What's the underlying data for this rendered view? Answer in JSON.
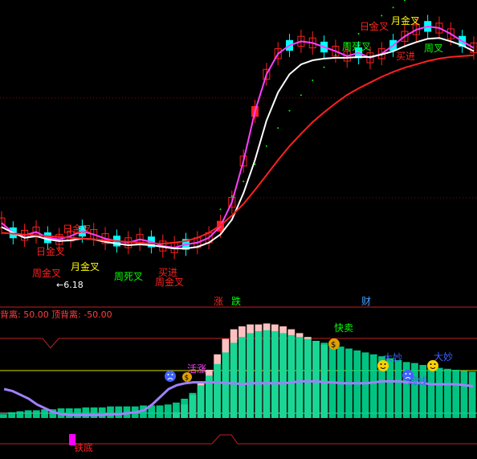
{
  "chart_data": [
    {
      "type": "candlestick",
      "panel": "main",
      "series": [
        {
          "name": "",
          "color": "#ff40ff",
          "values": [
            15.0,
            13.8,
            13.5,
            13.9,
            13.2,
            13.0,
            13.4,
            14.0,
            13.6,
            13.1,
            12.8,
            12.6,
            13.0,
            12.7,
            12.2,
            12.0,
            12.4,
            12.6,
            13.2,
            14.6,
            17.5,
            22.5,
            28.5,
            33.0,
            35.5,
            36.5,
            37.0,
            36.8,
            36.3,
            35.8,
            35.2,
            35.6,
            35.0,
            35.5,
            36.5,
            37.6,
            38.4,
            38.8,
            38.6,
            37.9,
            37.0,
            36.2
          ]
        },
        {
          "name": "",
          "color": "#ffffff",
          "values": [
            14.5,
            13.8,
            13.2,
            13.4,
            13.0,
            12.8,
            12.9,
            13.1,
            13.0,
            12.7,
            12.5,
            12.3,
            12.4,
            12.3,
            12.1,
            11.9,
            11.9,
            12.1,
            12.6,
            13.6,
            15.4,
            18.6,
            22.6,
            27.4,
            30.8,
            33.0,
            34.2,
            34.7,
            34.9,
            35.0,
            35.0,
            35.1,
            35.1,
            35.4,
            35.8,
            36.4,
            36.9,
            37.3,
            37.4,
            37.0,
            36.5,
            35.8
          ]
        },
        {
          "name": "",
          "color": "#ff2020",
          "values": [
            13.8,
            13.7,
            13.6,
            13.5,
            13.4,
            13.3,
            13.2,
            13.1,
            13.0,
            12.9,
            12.8,
            12.7,
            12.6,
            12.5,
            12.5,
            12.6,
            12.8,
            13.2,
            13.8,
            14.7,
            15.9,
            17.3,
            19.0,
            20.8,
            22.6,
            24.3,
            25.8,
            27.2,
            28.4,
            29.5,
            30.5,
            31.3,
            32.0,
            32.7,
            33.3,
            33.8,
            34.2,
            34.6,
            34.9,
            35.1,
            35.2,
            35.3
          ]
        }
      ],
      "annotations": [
        {
          "text": "日金叉",
          "color": "#ff2020"
        },
        {
          "text": "日金叉",
          "color": "#ff2020"
        },
        {
          "text": "月金叉",
          "color": "#ffff00"
        },
        {
          "text": "周金叉",
          "color": "#ff2020"
        },
        {
          "text": "周金叉",
          "color": "#ff2020"
        },
        {
          "text": "买进",
          "color": "#ff2020"
        },
        {
          "text": "买进",
          "color": "#ff2020"
        },
        {
          "text": "周死叉",
          "color": "#00ff00"
        },
        {
          "text": "周死叉",
          "color": "#00ff00"
        },
        {
          "text": "周叉",
          "color": "#00ff00"
        },
        {
          "text": "日金叉",
          "color": "#ff2020"
        },
        {
          "text": "月金叉",
          "color": "#ffff00"
        },
        {
          "text": "←6.18",
          "color": "#ffffff"
        }
      ]
    },
    {
      "type": "bar",
      "panel": "indicator",
      "labels": {
        "bottom_divergence": "背离: 50.00",
        "top_divergence": "顶背离: -50.00"
      },
      "tags": [
        {
          "text": "涨",
          "color": "#ff2020"
        },
        {
          "text": "跌",
          "color": "#00ff00"
        },
        {
          "text": "财",
          "color": "#40a0ff"
        }
      ],
      "annotations": [
        {
          "text": "快卖",
          "color": "#00ff00"
        },
        {
          "text": "大妙",
          "color": "#4060ff"
        },
        {
          "text": "大妙",
          "color": "#4060ff"
        },
        {
          "text": "周线",
          "color": "#4060ff"
        },
        {
          "text": "活涨",
          "color": "#ff40ff"
        },
        {
          "text": "铁底",
          "color": "#ff2020"
        }
      ],
      "series": [
        {
          "name": "",
          "color": "#00d890",
          "values": [
            4,
            6,
            7,
            8,
            8,
            9,
            9,
            10,
            10,
            10,
            11,
            11,
            11,
            12,
            12,
            12,
            12,
            13,
            13,
            13,
            14,
            16,
            20,
            26,
            34,
            44,
            56,
            68,
            78,
            84,
            88,
            90,
            91,
            90,
            88,
            86,
            84,
            82,
            80,
            78,
            76,
            74,
            72,
            70,
            68,
            66,
            64,
            62,
            60,
            58,
            57,
            55,
            54,
            52,
            51,
            50,
            49,
            48
          ]
        },
        {
          "name": "",
          "color": "#ffc0c0",
          "values": [
            0,
            0,
            0,
            0,
            0,
            0,
            0,
            0,
            0,
            0,
            0,
            0,
            0,
            0,
            0,
            0,
            0,
            0,
            0,
            0,
            0,
            6,
            14,
            24,
            36,
            50,
            66,
            82,
            92,
            95,
            97,
            97,
            98,
            97,
            95,
            92,
            88,
            84,
            80,
            76,
            0,
            0,
            0,
            0,
            0,
            0,
            0,
            0,
            0,
            0,
            0,
            0,
            0,
            0,
            0,
            0,
            0,
            0
          ]
        },
        {
          "name": "",
          "color": "#a080ff",
          "values": [
            30,
            28,
            24,
            20,
            14,
            10,
            6,
            4,
            3,
            3,
            3,
            3,
            3,
            4,
            4,
            5,
            6,
            8,
            14,
            22,
            30,
            34,
            36,
            37,
            37,
            37,
            37,
            36,
            36,
            35,
            36,
            36,
            36,
            36,
            36,
            37,
            38,
            38,
            38,
            37,
            37,
            36,
            36,
            36,
            36,
            37,
            38,
            38,
            38,
            37,
            37,
            36,
            35,
            35,
            35,
            35,
            34,
            33
          ]
        }
      ]
    }
  ]
}
